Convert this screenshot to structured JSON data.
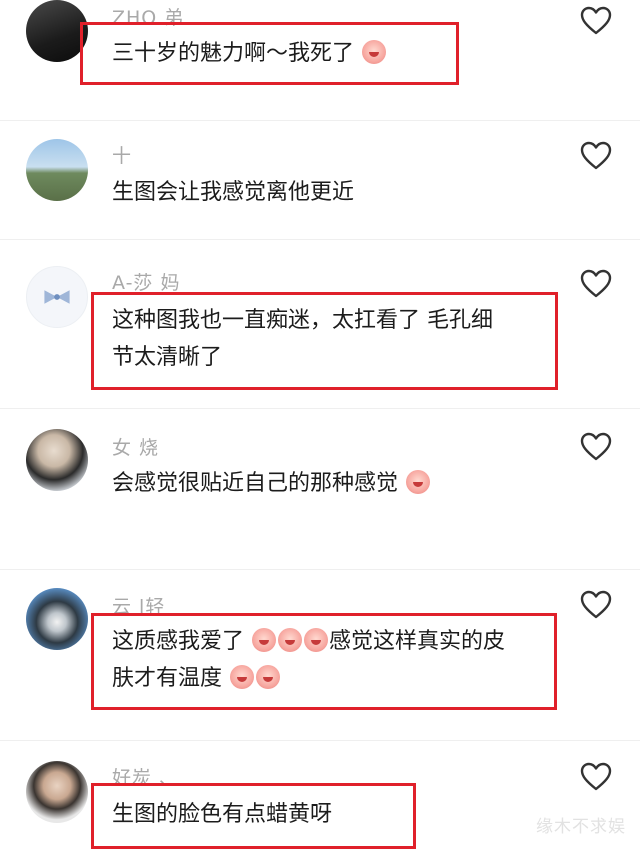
{
  "comments": [
    {
      "name": "ZHO          弟",
      "text": "三十岁的魅力啊～我死了",
      "emojis": [
        "crying-face"
      ]
    },
    {
      "name": "十",
      "text": "生图会让我感觉离他更近",
      "emojis": []
    },
    {
      "name": "A-莎                        妈",
      "line1": "这种图我也一直痴迷，太扛看了 毛孔细",
      "line2": "节太清晰了",
      "emojis": []
    },
    {
      "name": "女          烧",
      "text": "会感觉很贴近自己的那种感觉",
      "emojis": [
        "crying-face"
      ]
    },
    {
      "name": "云       l轻",
      "line1_a": "这质感我爱了",
      "line1_b": "感觉这样真实的皮",
      "line2": "肤才有温度",
      "emojis": [
        "peach-face",
        "peach-face",
        "peach-face",
        "heart-eyes-face",
        "peach-face"
      ]
    },
    {
      "name": "好炭                  、",
      "text": "生图的脸色有点蜡黄呀",
      "emojis": []
    }
  ],
  "watermark": "缘木不求娱",
  "colors": {
    "highlight_box": "#e0202a",
    "username": "#a9a9a9",
    "text": "#1c1c1c"
  }
}
